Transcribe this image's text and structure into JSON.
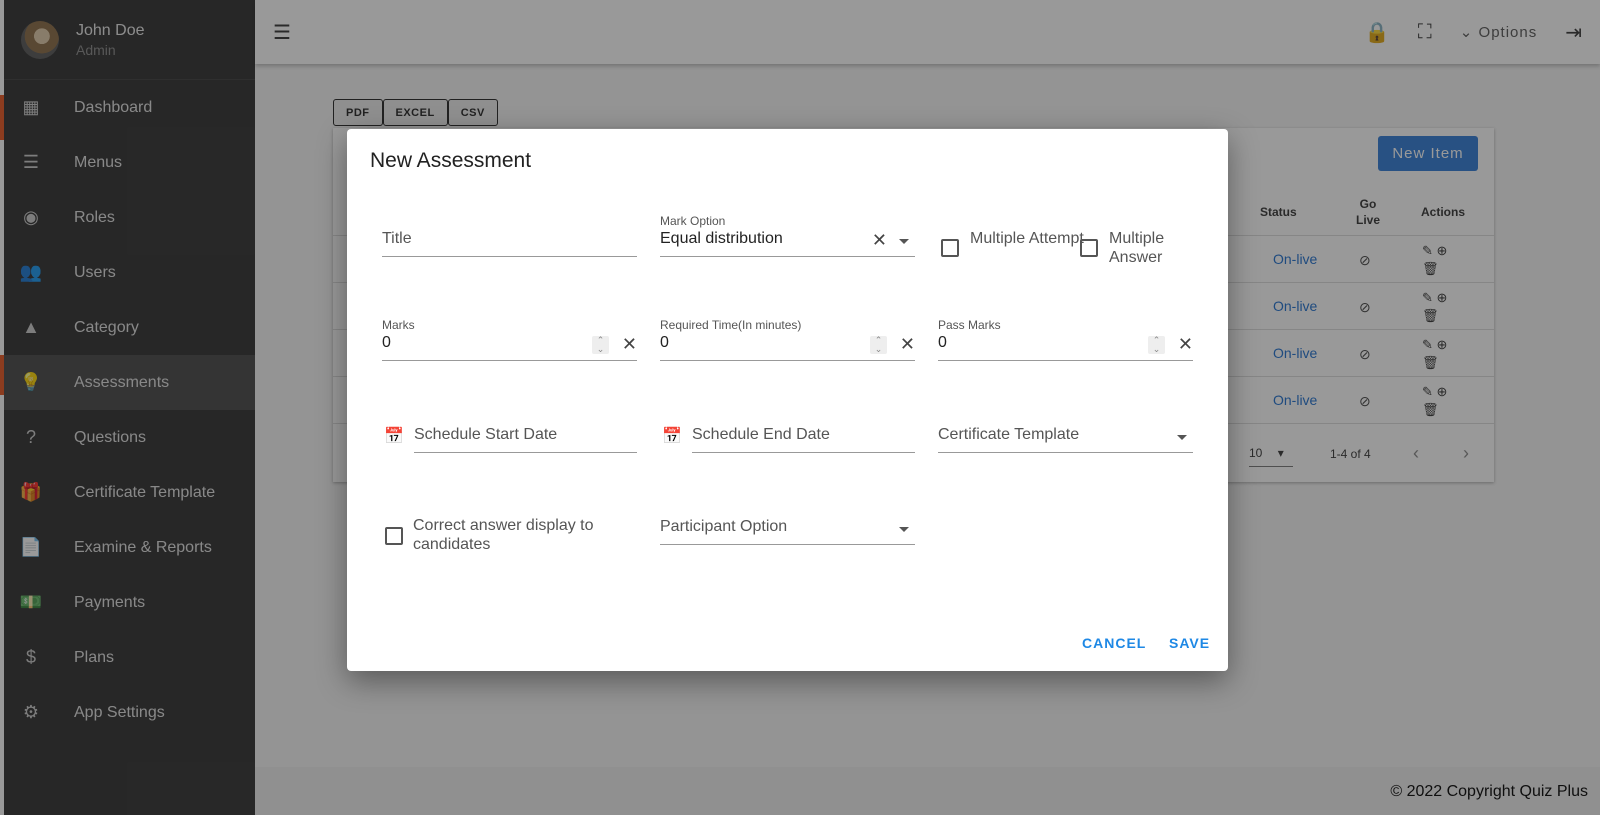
{
  "user": {
    "name": "John Doe",
    "role": "Admin"
  },
  "sidebar": {
    "items": [
      {
        "label": "Dashboard",
        "icon": "dashboard-icon",
        "glyph": "▦"
      },
      {
        "label": "Menus",
        "icon": "menu-open-icon",
        "glyph": "☰"
      },
      {
        "label": "Roles",
        "icon": "roles-icon",
        "glyph": "◉"
      },
      {
        "label": "Users",
        "icon": "users-icon",
        "glyph": "👥"
      },
      {
        "label": "Category",
        "icon": "category-icon",
        "glyph": "▲"
      },
      {
        "label": "Assessments",
        "icon": "lightbulb-icon",
        "glyph": "💡",
        "active": true
      },
      {
        "label": "Questions",
        "icon": "help-box-icon",
        "glyph": "?"
      },
      {
        "label": "Certificate Template",
        "icon": "card-giftcard-icon",
        "glyph": "🎁"
      },
      {
        "label": "Examine & Reports",
        "icon": "document-icon",
        "glyph": "📄"
      },
      {
        "label": "Payments",
        "icon": "payments-icon",
        "glyph": "💵"
      },
      {
        "label": "Plans",
        "icon": "dollar-icon",
        "glyph": "$"
      },
      {
        "label": "App Settings",
        "icon": "gear-icon",
        "glyph": "⚙"
      }
    ]
  },
  "header": {
    "options_label": "Options"
  },
  "exports": [
    "PDF",
    "EXCEL",
    "CSV"
  ],
  "table": {
    "new_item_label": "New Item",
    "headers": {
      "status": "Status",
      "go_live": "Go Live",
      "actions": "Actions"
    },
    "rows": [
      {
        "status": "On-live"
      },
      {
        "status": "On-live"
      },
      {
        "status": "On-live"
      },
      {
        "status": "On-live"
      }
    ],
    "rows_per_page": "10",
    "range": "1-4 of 4"
  },
  "footer": "© 2022 Copyright Quiz Plus",
  "modal": {
    "title": "New Assessment",
    "title_placeholder": "Title",
    "mark_option_label": "Mark Option",
    "mark_option_value": "Equal distribution",
    "multiple_attempt": "Multiple Attempt",
    "multiple_answer": "Multiple Answer",
    "marks_label": "Marks",
    "marks_value": "0",
    "required_time_label": "Required Time(In minutes)",
    "required_time_value": "0",
    "pass_marks_label": "Pass Marks",
    "pass_marks_value": "0",
    "start_date_placeholder": "Schedule Start Date",
    "end_date_placeholder": "Schedule End Date",
    "certificate_placeholder": "Certificate Template",
    "correct_answer_label": "Correct answer display to candidates",
    "participant_placeholder": "Participant Option",
    "cancel": "CANCEL",
    "save": "SAVE"
  }
}
